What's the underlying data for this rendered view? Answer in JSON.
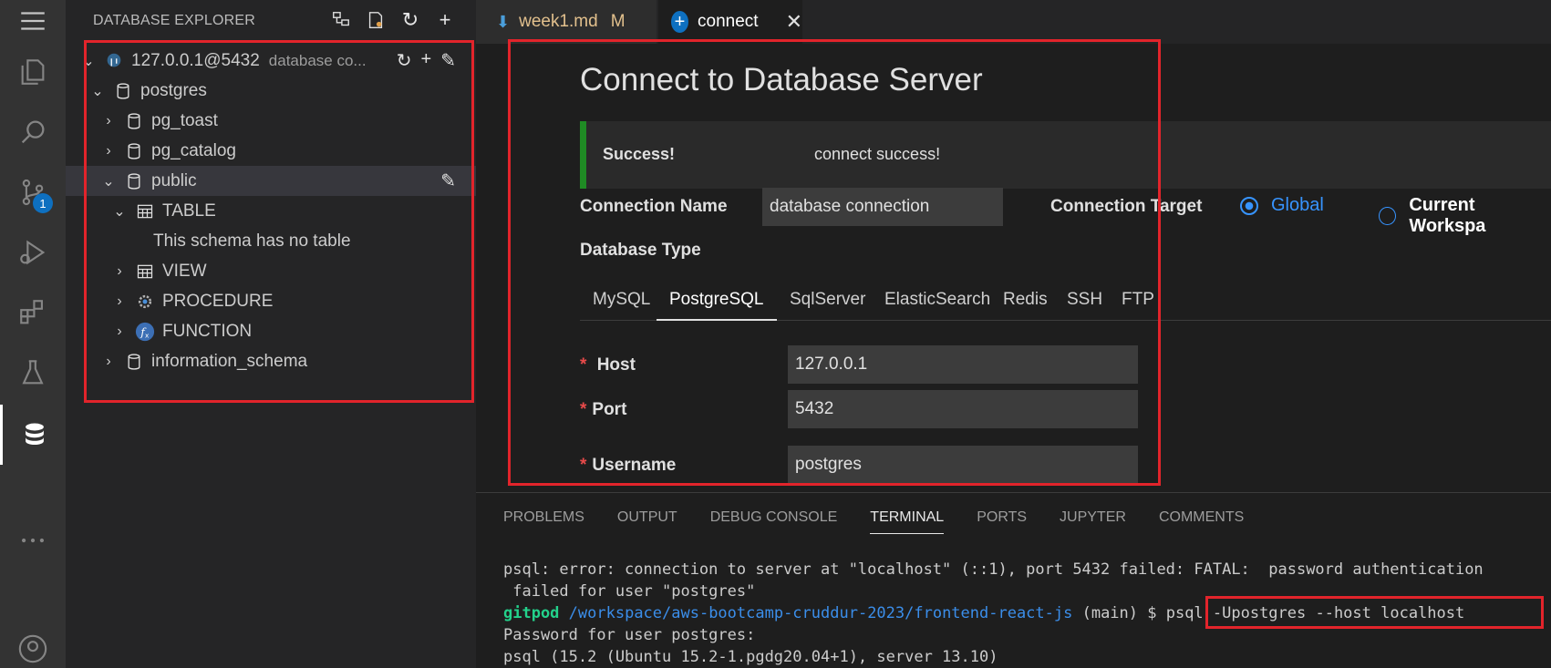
{
  "activity_bar": {
    "items": [
      "menu-icon",
      "files-icon",
      "search-icon",
      "source-control-icon",
      "run-debug-icon",
      "extensions-icon",
      "testing-icon",
      "database-icon",
      "more-icon",
      "account-icon"
    ],
    "scm_badge": "1"
  },
  "sidebar": {
    "title": "DATABASE EXPLORER",
    "connection": {
      "label": "127.0.0.1@5432",
      "description": "database co..."
    },
    "tree": [
      {
        "label": "postgres"
      },
      {
        "label": "pg_toast"
      },
      {
        "label": "pg_catalog"
      },
      {
        "label": "public"
      },
      {
        "label": "TABLE"
      },
      {
        "label": "This schema has no table"
      },
      {
        "label": "VIEW"
      },
      {
        "label": "PROCEDURE"
      },
      {
        "label": "FUNCTION"
      },
      {
        "label": "information_schema"
      }
    ]
  },
  "tabs": [
    {
      "label": "week1.md",
      "status": "M"
    },
    {
      "label": "connect"
    }
  ],
  "connect_page": {
    "title": "Connect to Database Server",
    "alert": {
      "title": "Success!",
      "message": "connect success!"
    },
    "connection_name_label": "Connection Name",
    "connection_name_value": "database connection",
    "connection_target_label": "Connection Target",
    "target_options": [
      "Global",
      "Current Workspa"
    ],
    "selected_target": "Global",
    "database_type_label": "Database Type",
    "db_types": [
      "MySQL",
      "PostgreSQL",
      "SqlServer",
      "ElasticSearch",
      "Redis",
      "SSH",
      "FTP"
    ],
    "selected_db_type": "PostgreSQL",
    "host_label": "Host",
    "host_value": "127.0.0.1",
    "port_label": "Port",
    "port_value": "5432",
    "username_label": "Username",
    "username_value": "postgres",
    "required_mark": "*"
  },
  "panel": {
    "tabs": [
      "PROBLEMS",
      "OUTPUT",
      "DEBUG CONSOLE",
      "TERMINAL",
      "PORTS",
      "JUPYTER",
      "COMMENTS"
    ],
    "active_tab": "TERMINAL",
    "terminal": {
      "line1": "psql: error: connection to server at \"localhost\" (::1), port 5432 failed: FATAL:  password authentication",
      "line2": " failed for user \"postgres\"",
      "prompt_user": "gitpod",
      "prompt_path": "/workspace/aws-bootcamp-cruddur-2023/frontend-react-js",
      "prompt_branch": " (main) $ ",
      "command": "psql -Upostgres --host localhost",
      "line4": "Password for user postgres:",
      "line5": "psql (15.2 (Ubuntu 15.2-1.pgdg20.04+1), server 13.10)"
    }
  },
  "colors": {
    "accent": "#3794ff",
    "success": "#1f8b24",
    "highlight_box": "#e2242b",
    "modified": "#e2c08d"
  }
}
